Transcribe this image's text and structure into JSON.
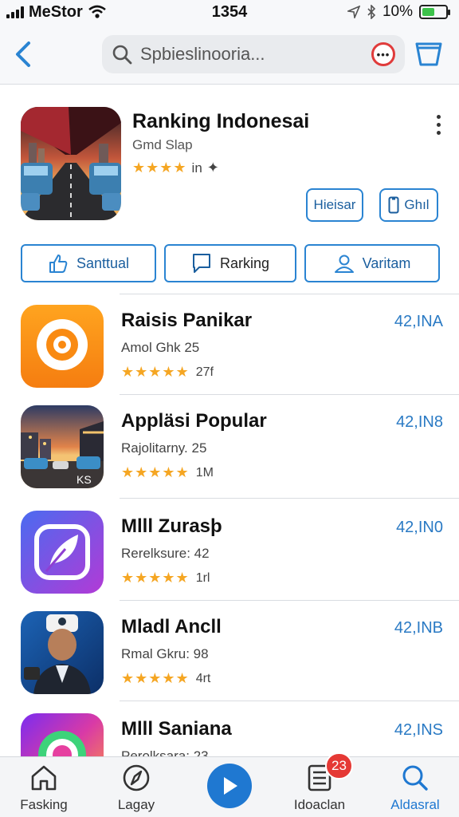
{
  "status_bar": {
    "carrier": "MeStor",
    "time": "1354",
    "battery": "10%",
    "battery_level": 0.55
  },
  "search": {
    "placeholder": "Spbieslinooria..."
  },
  "featured": {
    "title": "Ranking Indonesai",
    "subtitle": "Gmd Slap",
    "stars": "★★★★",
    "rating_text": "in",
    "button_1": "Hieisar",
    "button_2": "Ghıl"
  },
  "tabs": [
    {
      "label": "Santtual",
      "icon": "thumbs-up-icon"
    },
    {
      "label": "Rarking",
      "icon": "chat-bubble-icon"
    },
    {
      "label": "Varitam",
      "icon": "person-icon"
    }
  ],
  "apps": [
    {
      "name": "Raisis Panikar",
      "desc": "Amol Ghk 25",
      "stars": "★★★★★",
      "count": "27f",
      "price": "42,INA"
    },
    {
      "name": "Appläsi Popular",
      "desc": "Rajolitarny. 25",
      "stars": "★★★★★",
      "count": "1M",
      "price": "42,IN8",
      "icon_text": "KS"
    },
    {
      "name": "Mlll Zurasþ",
      "desc": "Rerelksure: 42",
      "stars": "★★★★★",
      "count": "1rl",
      "price": "42,IN0"
    },
    {
      "name": "Mladl Ancll",
      "desc": "Rmal Gkru: 98",
      "stars": "★★★★★",
      "count": "4rt",
      "price": "42,INB"
    },
    {
      "name": "Mlll Saniana",
      "desc": "Perolksara: 23",
      "stars": "★★★★★",
      "count": "",
      "price": "42,INS"
    }
  ],
  "bottom_nav": {
    "items": [
      {
        "label": "Fasking",
        "icon": "home-icon"
      },
      {
        "label": "Lagay",
        "icon": "compass-icon"
      },
      {
        "label": "",
        "icon": "play-icon"
      },
      {
        "label": "Idoaclan",
        "icon": "list-icon",
        "badge": "23"
      },
      {
        "label": "Aldasral",
        "icon": "search-icon"
      }
    ]
  },
  "colors": {
    "accent": "#2a84d2",
    "star": "#f5a623",
    "price": "#2a7ac4",
    "badge": "#e53935"
  }
}
